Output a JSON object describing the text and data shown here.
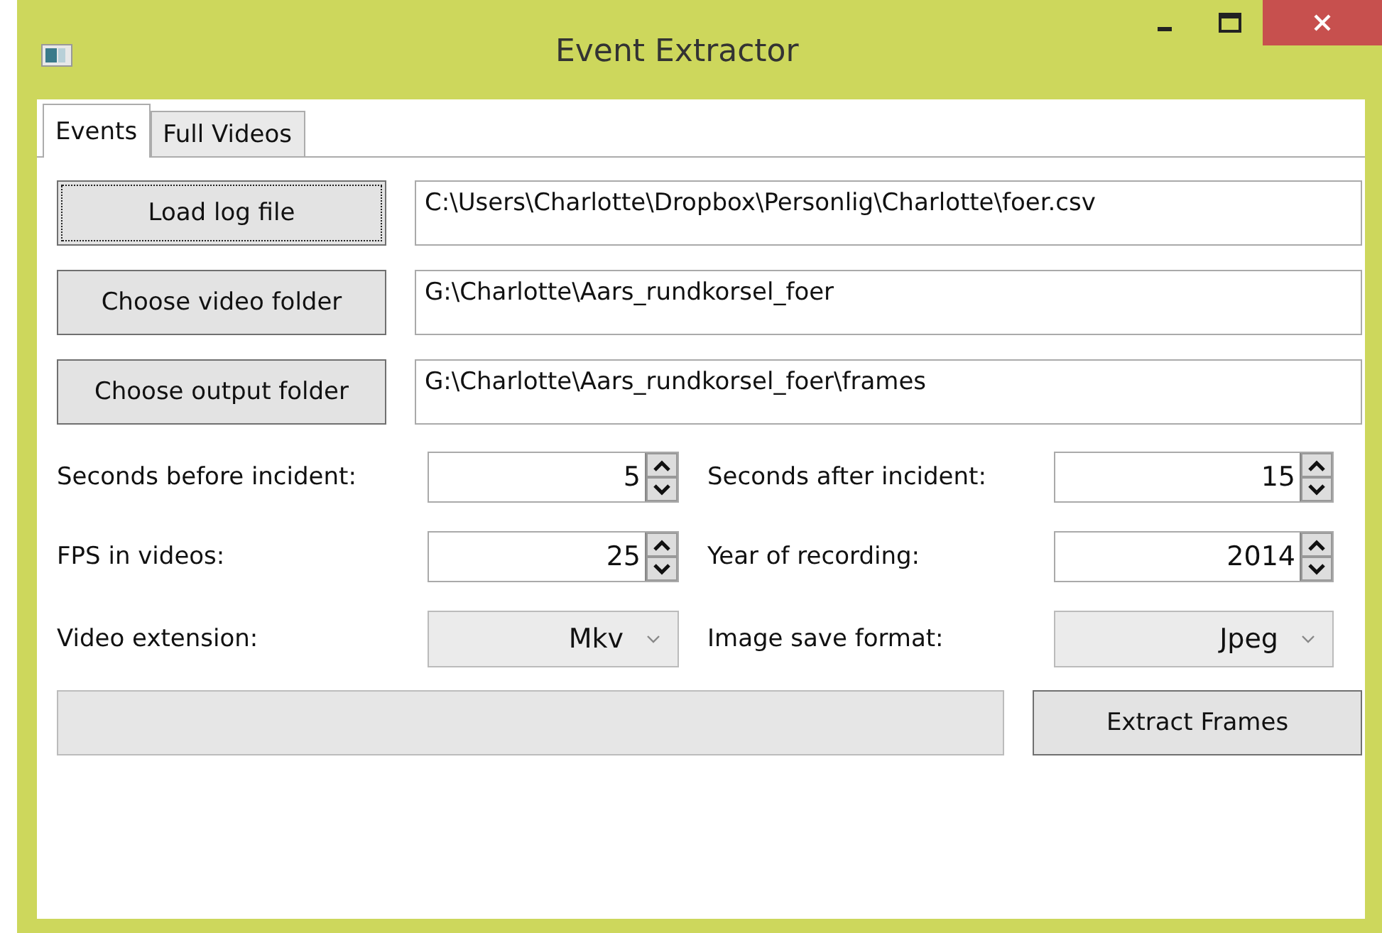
{
  "window": {
    "title": "Event Extractor"
  },
  "tabs": [
    {
      "label": "Events",
      "selected": true
    },
    {
      "label": "Full Videos",
      "selected": false
    }
  ],
  "path_rows": [
    {
      "button": "Load log file",
      "focused": true,
      "value": "C:\\Users\\Charlotte\\Dropbox\\Personlig\\Charlotte\\foer.csv"
    },
    {
      "button": "Choose video folder",
      "focused": false,
      "value": "G:\\Charlotte\\Aars_rundkorsel_foer"
    },
    {
      "button": "Choose output folder",
      "focused": false,
      "value": "G:\\Charlotte\\Aars_rundkorsel_foer\\frames"
    }
  ],
  "settings": [
    {
      "kind": "spinner",
      "label": "Seconds before incident:",
      "value": "5"
    },
    {
      "kind": "spinner",
      "label": "Seconds after incident:",
      "value": "15"
    },
    {
      "kind": "spinner",
      "label": "FPS in videos:",
      "value": "25"
    },
    {
      "kind": "spinner",
      "label": "Year of recording:",
      "value": "2014"
    },
    {
      "kind": "dropdown",
      "label": "Video extension:",
      "value": "Mkv"
    },
    {
      "kind": "dropdown",
      "label": "Image save format:",
      "value": "Jpeg"
    }
  ],
  "progress": {
    "level": 0
  },
  "action_button": "Extract Frames"
}
